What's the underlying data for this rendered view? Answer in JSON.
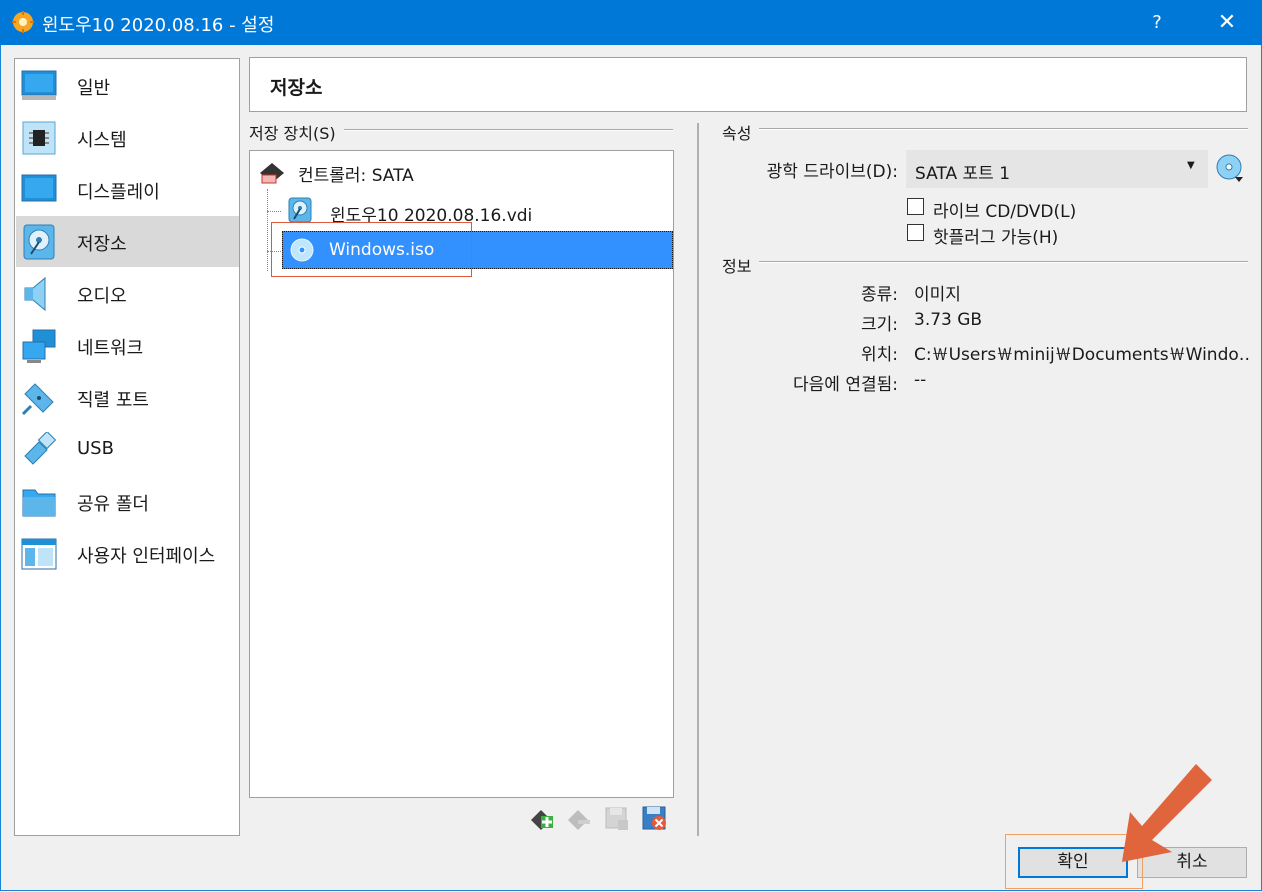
{
  "window": {
    "title": "윈도우10 2020.08.16 - 설정",
    "help_label": "?",
    "close_label": "✕"
  },
  "nav": {
    "items": [
      {
        "label": "일반",
        "icon": "monitor-icon"
      },
      {
        "label": "시스템",
        "icon": "chip-icon"
      },
      {
        "label": "디스플레이",
        "icon": "display-icon"
      },
      {
        "label": "저장소",
        "icon": "storage-disk-icon",
        "selected": true
      },
      {
        "label": "오디오",
        "icon": "speaker-icon"
      },
      {
        "label": "네트워크",
        "icon": "network-icon"
      },
      {
        "label": "직렬 포트",
        "icon": "serial-port-icon"
      },
      {
        "label": "USB",
        "icon": "usb-icon"
      },
      {
        "label": "공유 폴더",
        "icon": "folder-icon"
      },
      {
        "label": "사용자 인터페이스",
        "icon": "ui-window-icon"
      }
    ]
  },
  "page": {
    "title": "저장소"
  },
  "storage": {
    "caption": "저장 장치(S)",
    "caption_mnemonic": "S",
    "controller_label": "컨트롤러: SATA",
    "disk_label": "윈도우10 2020.08.16.vdi",
    "optical_label": "Windows.iso"
  },
  "attributes": {
    "caption": "속성",
    "optical_drive_label": "광학 드라이브(D):",
    "optical_drive_value": "SATA 포트 1",
    "live_cd_label": "라이브 CD/DVD(L)",
    "hotplug_label": "핫플러그 가능(H)"
  },
  "info": {
    "caption": "정보",
    "rows": [
      {
        "label": "종류:",
        "value": "이미지"
      },
      {
        "label": "크기:",
        "value": "3.73 GB"
      },
      {
        "label": "위치:",
        "value": "C:￦Users￦minij￦Documents￦Windo…"
      },
      {
        "label": "다음에 연결됨:",
        "value": "--"
      }
    ]
  },
  "buttons": {
    "ok": "확인",
    "cancel": "취소"
  },
  "colors": {
    "titlebar": "#0078d7",
    "selection": "#3390ff",
    "annotation_red": "#e0583a",
    "annotation_orange": "#e0643c"
  }
}
